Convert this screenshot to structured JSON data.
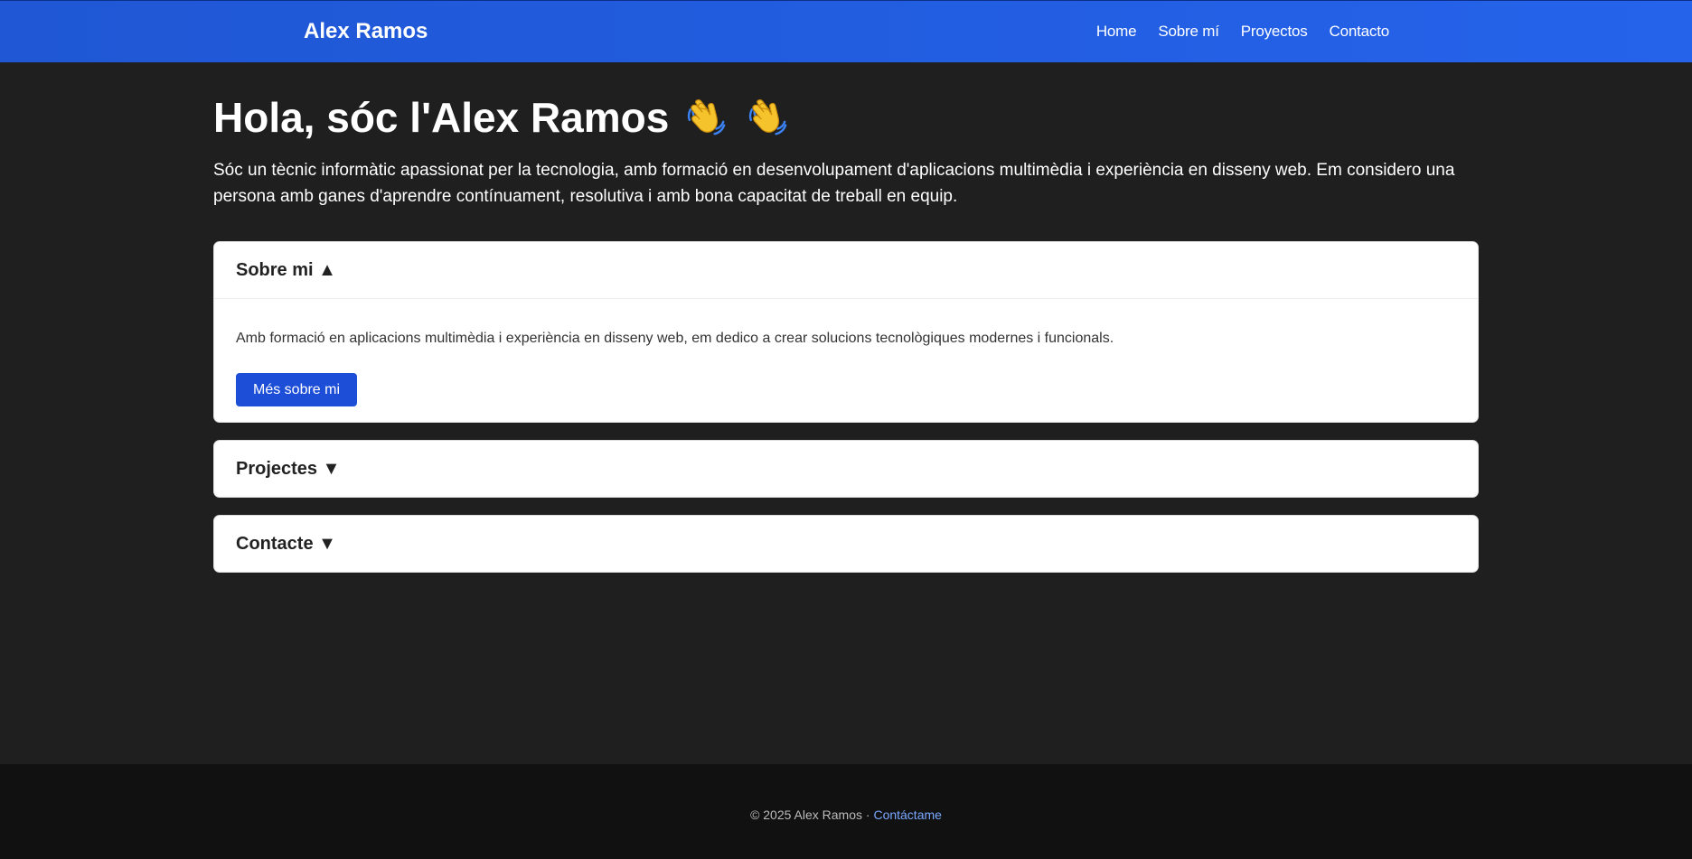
{
  "navbar": {
    "brand": "Alex Ramos",
    "links": [
      "Home",
      "Sobre mí",
      "Proyectos",
      "Contacto"
    ],
    "background": "#2563eb"
  },
  "hero": {
    "title": "Hola, sóc l'Alex Ramos",
    "icons": [
      "waving-hand-icon",
      "waving-hand-icon"
    ],
    "text": "Sóc un tècnic informàtic apassionat per la tecnologia, amb formació en desenvolupament d'aplicacions multimèdia i experiència en disseny web. Em considero una persona amb ganes d'aprendre contínuament, resolutiva i amb bona capacitat de treball en equip."
  },
  "sections": [
    {
      "title": "Sobre mi ▲",
      "expanded": true,
      "body": "Amb formació en aplicacions multimèdia i experiència en disseny web, em dedico a crear solucions tecnològiques modernes i funcionals.",
      "button": "Més sobre mi"
    },
    {
      "title": "Projectes ▼",
      "expanded": false
    },
    {
      "title": "Contacte ▼",
      "expanded": false
    }
  ],
  "footer": {
    "copyright": "© 2025 Alex Ramos · ",
    "link": "Contáctame"
  },
  "colors": {
    "accent": "#1d4ed8",
    "page_background": "#1f1f1f",
    "footer_background": "#111111",
    "footer_link": "#7aa7ff"
  }
}
